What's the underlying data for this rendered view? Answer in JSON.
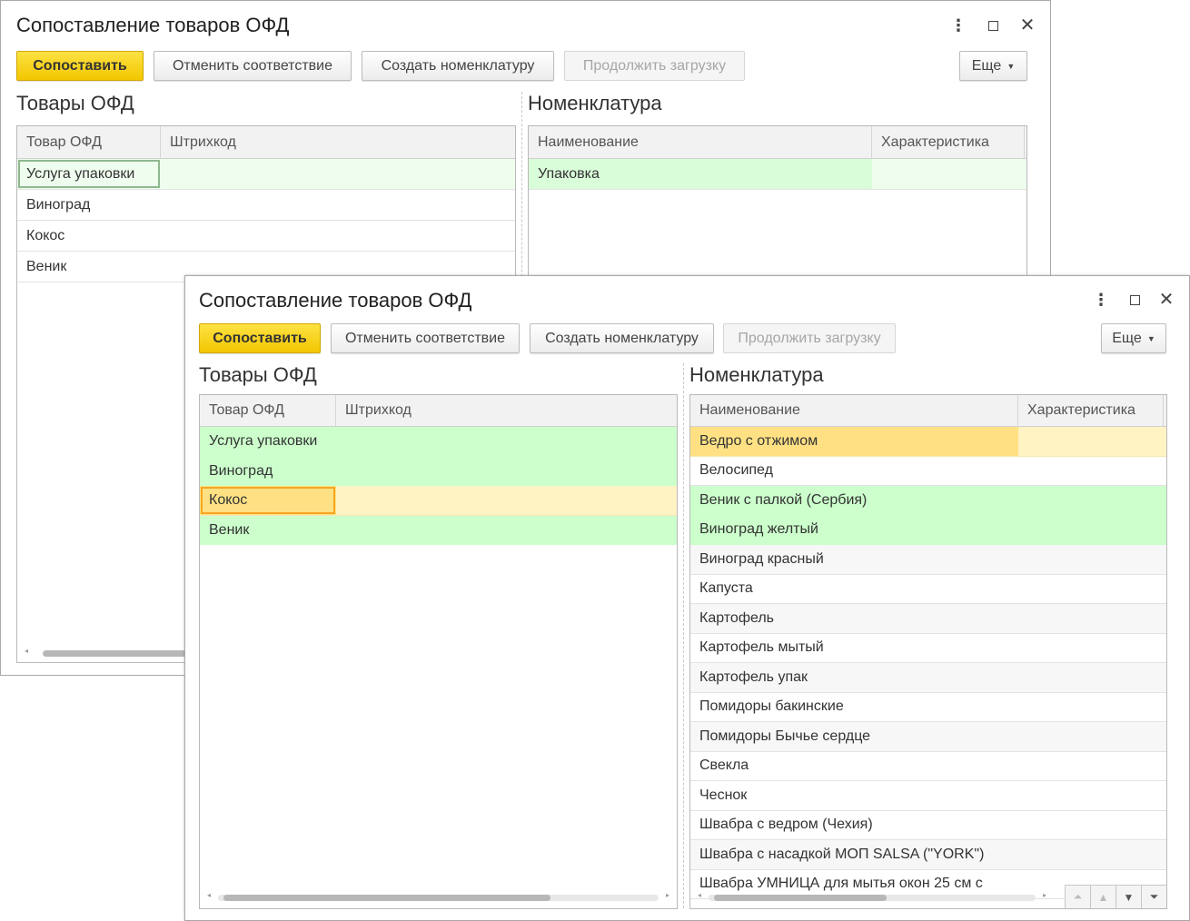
{
  "window1": {
    "title": "Сопоставление товаров ОФД",
    "toolbar": {
      "match_label": "Сопоставить",
      "cancel_match_label": "Отменить соответствие",
      "create_nomenclature_label": "Создать номенклатуру",
      "continue_load_label": "Продолжить загрузку",
      "more_label": "Еще"
    },
    "ofd_goods": {
      "title": "Товары ОФД",
      "columns": [
        "Товар ОФД",
        "Штрихкод"
      ],
      "rows": [
        "Услуга упаковки",
        "Виноград",
        "Кокос",
        "Веник"
      ]
    },
    "nomenclature": {
      "title": "Номенклатура",
      "columns": [
        "Наименование",
        "Характеристика"
      ],
      "rows": [
        "Упаковка"
      ]
    }
  },
  "window2": {
    "title": "Сопоставление товаров ОФД",
    "toolbar": {
      "match_label": "Сопоставить",
      "cancel_match_label": "Отменить соответствие",
      "create_nomenclature_label": "Создать номенклатуру",
      "continue_load_label": "Продолжить загрузку",
      "more_label": "Еще"
    },
    "ofd_goods": {
      "title": "Товары ОФД",
      "columns": [
        "Товар ОФД",
        "Штрихкод"
      ],
      "rows": [
        "Услуга упаковки",
        "Виноград",
        "Кокос",
        "Веник"
      ]
    },
    "nomenclature": {
      "title": "Номенклатура",
      "columns": [
        "Наименование",
        "Характеристика"
      ],
      "rows": [
        "Ведро с отжимом",
        "Велосипед",
        "Веник с палкой (Сербия)",
        "Виноград желтый",
        "Виноград красный",
        "Капуста",
        "Картофель",
        "Картофель мытый",
        "Картофель упак",
        "Помидоры бакинские",
        "Помидоры Бычье сердце",
        "Свекла",
        "Чеснок",
        "Швабра с ведром (Чехия)",
        "Швабра с насадкой МОП SALSA (\"YORK\")",
        "Швабра УМНИЦА для мытья окон 25 см с"
      ]
    }
  },
  "colors": {
    "accent_yellow": "#f2c600",
    "matched_green": "#ccffcc",
    "selected_orange": "#ffe184"
  }
}
